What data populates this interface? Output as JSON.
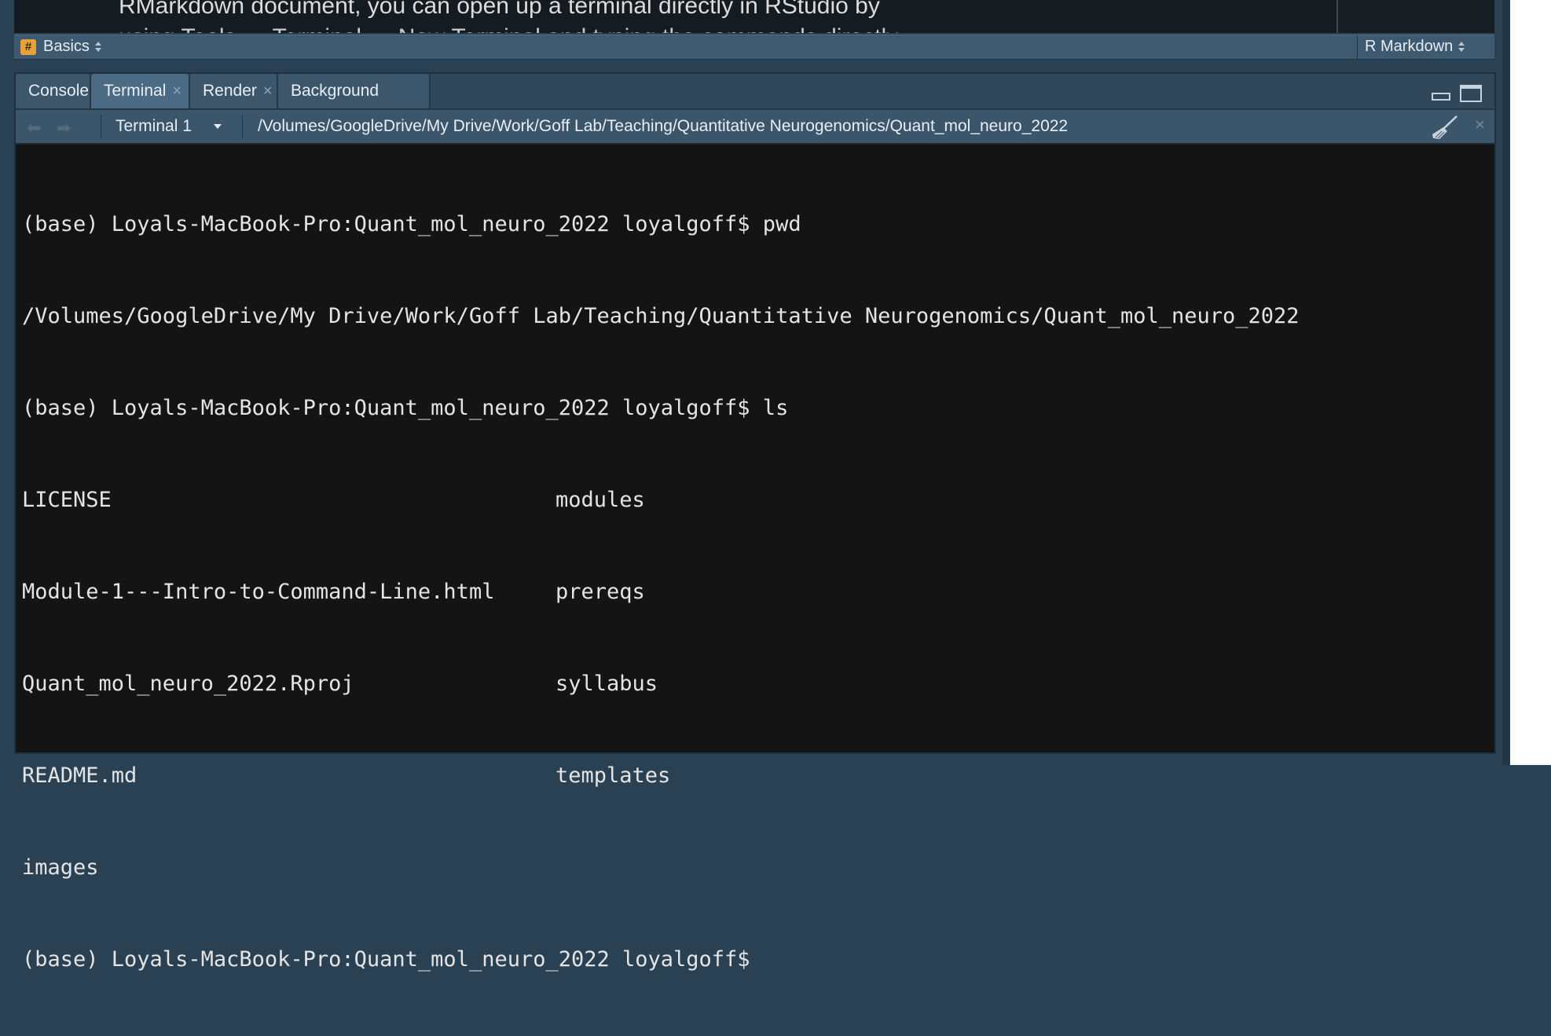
{
  "editor": {
    "line1": "RMarkdown document, you can open up a terminal directly in RStudio by",
    "line2": "using  Tools  →  Terminal  →  New Terminal  and  typing  the  commands  directly"
  },
  "statusbar": {
    "section_icon": "#",
    "section_label": "Basics",
    "doc_type": "R Markdown"
  },
  "tabs": [
    {
      "label": "Console",
      "closable": false
    },
    {
      "label": "Terminal",
      "closable": true,
      "active": true
    },
    {
      "label": "Render",
      "closable": true
    },
    {
      "label": "Background Jobs",
      "closable": true
    }
  ],
  "toolbar": {
    "terminal_selector": "Terminal 1",
    "path": "/Volumes/GoogleDrive/My Drive/Work/Goff Lab/Teaching/Quantitative Neurogenomics/Quant_mol_neuro_2022"
  },
  "terminal": {
    "lines": [
      "(base) Loyals-MacBook-Pro:Quant_mol_neuro_2022 loyalgoff$ pwd",
      "/Volumes/GoogleDrive/My Drive/Work/Goff Lab/Teaching/Quantitative Neurogenomics/Quant_mol_neuro_2022",
      "(base) Loyals-MacBook-Pro:Quant_mol_neuro_2022 loyalgoff$ ls"
    ],
    "ls_rows": [
      [
        "LICENSE",
        "modules"
      ],
      [
        "Module-1---Intro-to-Command-Line.html",
        "prereqs"
      ],
      [
        "Quant_mol_neuro_2022.Rproj",
        "syllabus"
      ],
      [
        "README.md",
        "templates"
      ],
      [
        "images",
        ""
      ]
    ],
    "prompt": "(base) Loyals-MacBook-Pro:Quant_mol_neuro_2022 loyalgoff$"
  },
  "colors": {
    "pane_chrome": "#3b566b",
    "terminal_bg": "#141414",
    "section_badge": "#e9a238"
  }
}
